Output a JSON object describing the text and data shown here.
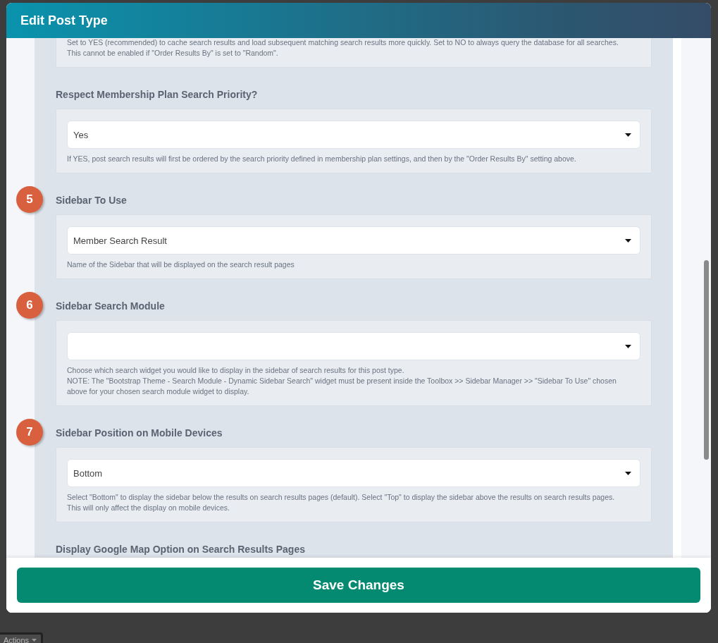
{
  "window": {
    "title": "Edit Post Type"
  },
  "settings": [
    {
      "help": [
        "Set to YES (recommended) to cache search results and load subsequent matching search results more quickly. Set to NO to always query the database for all searches. This cannot be enabled if \"Order Results By\" is set to \"Random\"."
      ]
    },
    {
      "label": "Respect Membership Plan Search Priority?",
      "value": "Yes",
      "help": [
        "If YES, post search results will first be ordered by the search priority defined in membership plan settings, and then by the \"Order Results By\" setting above."
      ]
    },
    {
      "step": "5",
      "label": "Sidebar To Use",
      "value": "Member Search Result",
      "help": [
        "Name of the Sidebar that will be displayed on the search result pages"
      ]
    },
    {
      "step": "6",
      "label": "Sidebar Search Module",
      "help": [
        "Choose which search widget you would like to display in the sidebar of search results for this post type.",
        "NOTE: The \"Bootstrap Theme - Search Module - Dynamic Sidebar Search\" widget must be present inside the Toolbox >> Sidebar Manager >> \"Sidebar To Use\" chosen above for your chosen search module widget to display."
      ]
    },
    {
      "step": "7",
      "label": "Sidebar Position on Mobile Devices",
      "value": "Bottom",
      "help": [
        "Select \"Bottom\" to display the sidebar below the results on search results pages (default). Select \"Top\" to display the sidebar above the results on search results pages. This will only affect the display on mobile devices."
      ]
    },
    {
      "label": "Display Google Map Option on Search Results Pages"
    }
  ],
  "save_button": "Save Changes",
  "background": {
    "actions_button": "Actions"
  }
}
